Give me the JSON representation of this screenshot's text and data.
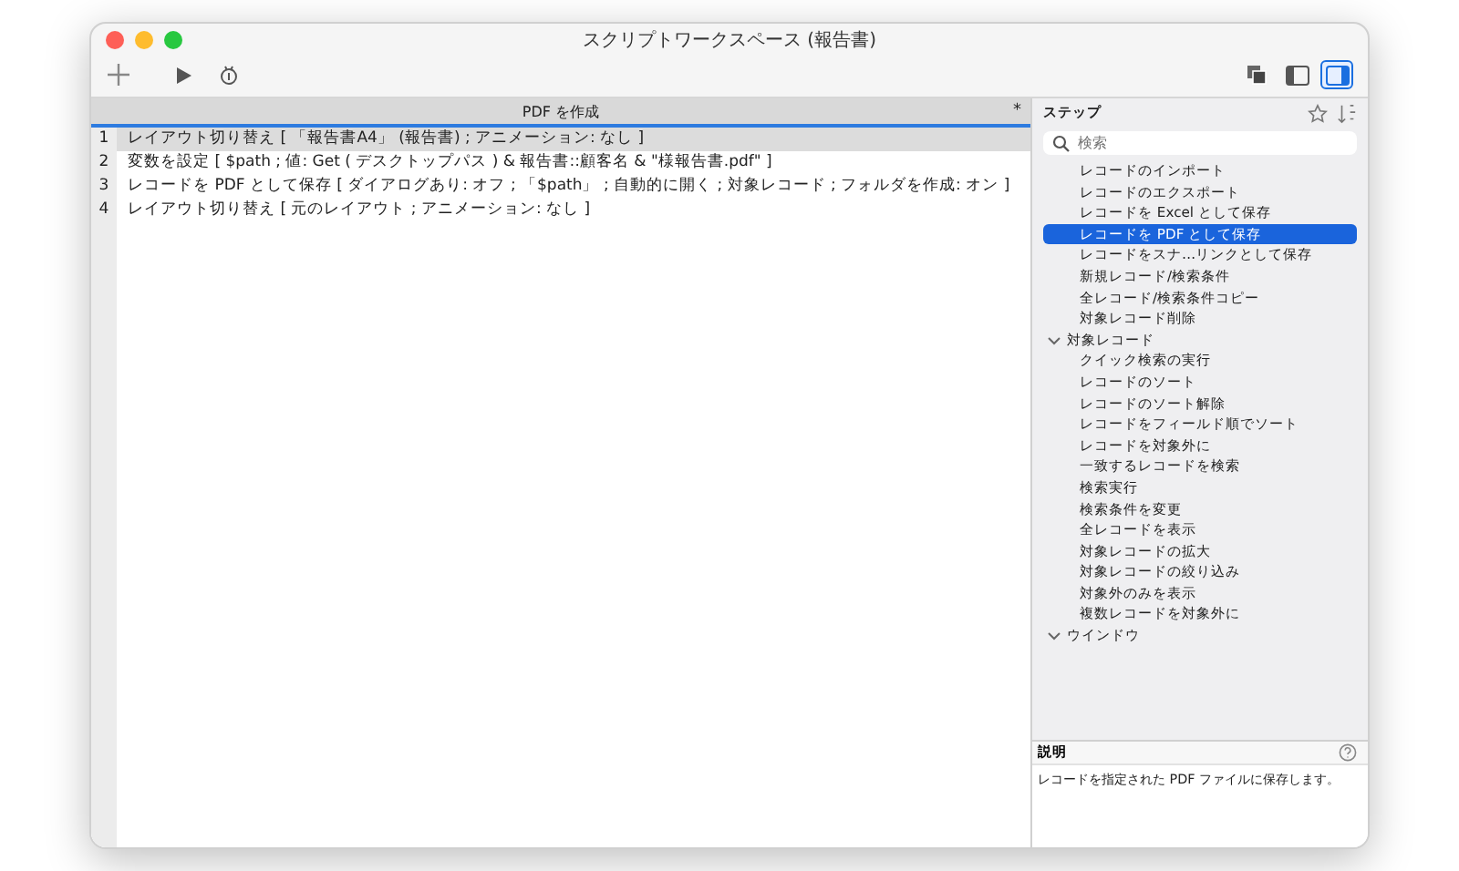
{
  "window": {
    "title": "スクリプトワークスペース (報告書)"
  },
  "toolbar": {
    "right_buttons": [
      {
        "kind": "copy",
        "selected": false
      },
      {
        "kind": "left-panel",
        "selected": false
      },
      {
        "kind": "right-panel",
        "selected": true
      }
    ]
  },
  "editor": {
    "tab": {
      "title": "PDF を作成",
      "modified_mark": "*"
    },
    "lines": [
      {
        "number": "1",
        "text": "レイアウト切り替え [ 「報告書A4」 (報告書) ; アニメーション: なし ]",
        "selected": true
      },
      {
        "number": "2",
        "text": "変数を設定 [ $path ; 値: Get ( デスクトップパス ) & 報告書::顧客名 & \"様報告書.pdf\" ]",
        "selected": false
      },
      {
        "number": "3",
        "text": "レコードを PDF として保存 [ ダイアログあり: オフ ; 「$path」 ; 自動的に開く ; 対象レコード ; フォルダを作成: オン ]",
        "selected": false
      },
      {
        "number": "4",
        "text": "レイアウト切り替え [ 元のレイアウト ; アニメーション: なし ]",
        "selected": false
      }
    ]
  },
  "steps": {
    "title": "ステップ",
    "search": {
      "placeholder": "検索"
    },
    "items": [
      {
        "kind": "step",
        "label": "レコードのインポート",
        "selected": false
      },
      {
        "kind": "step",
        "label": "レコードのエクスポート",
        "selected": false
      },
      {
        "kind": "step",
        "label": "レコードを Excel として保存",
        "selected": false
      },
      {
        "kind": "step",
        "label": "レコードを PDF として保存",
        "selected": true
      },
      {
        "kind": "step",
        "label": "レコードをスナ…リンクとして保存",
        "selected": false
      },
      {
        "kind": "step",
        "label": "新規レコード/検索条件",
        "selected": false
      },
      {
        "kind": "step",
        "label": "全レコード/検索条件コピー",
        "selected": false
      },
      {
        "kind": "step",
        "label": "対象レコード削除",
        "selected": false
      },
      {
        "kind": "category",
        "label": "対象レコード",
        "expanded": true,
        "children": [
          {
            "kind": "step",
            "label": "クイック検索の実行",
            "selected": false
          },
          {
            "kind": "step",
            "label": "レコードのソート",
            "selected": false
          },
          {
            "kind": "step",
            "label": "レコードのソート解除",
            "selected": false
          },
          {
            "kind": "step",
            "label": "レコードをフィールド順でソート",
            "selected": false
          },
          {
            "kind": "step",
            "label": "レコードを対象外に",
            "selected": false
          },
          {
            "kind": "step",
            "label": "一致するレコードを検索",
            "selected": false
          },
          {
            "kind": "step",
            "label": "検索実行",
            "selected": false
          },
          {
            "kind": "step",
            "label": "検索条件を変更",
            "selected": false
          },
          {
            "kind": "step",
            "label": "全レコードを表示",
            "selected": false
          },
          {
            "kind": "step",
            "label": "対象レコードの拡大",
            "selected": false
          },
          {
            "kind": "step",
            "label": "対象レコードの絞り込み",
            "selected": false
          },
          {
            "kind": "step",
            "label": "対象外のみを表示",
            "selected": false
          },
          {
            "kind": "step",
            "label": "複数レコードを対象外に",
            "selected": false
          }
        ]
      },
      {
        "kind": "category",
        "label": "ウインドウ",
        "expanded": true
      }
    ]
  },
  "description": {
    "title": "説明",
    "text": "レコードを指定された PDF ファイルに保存します。"
  }
}
